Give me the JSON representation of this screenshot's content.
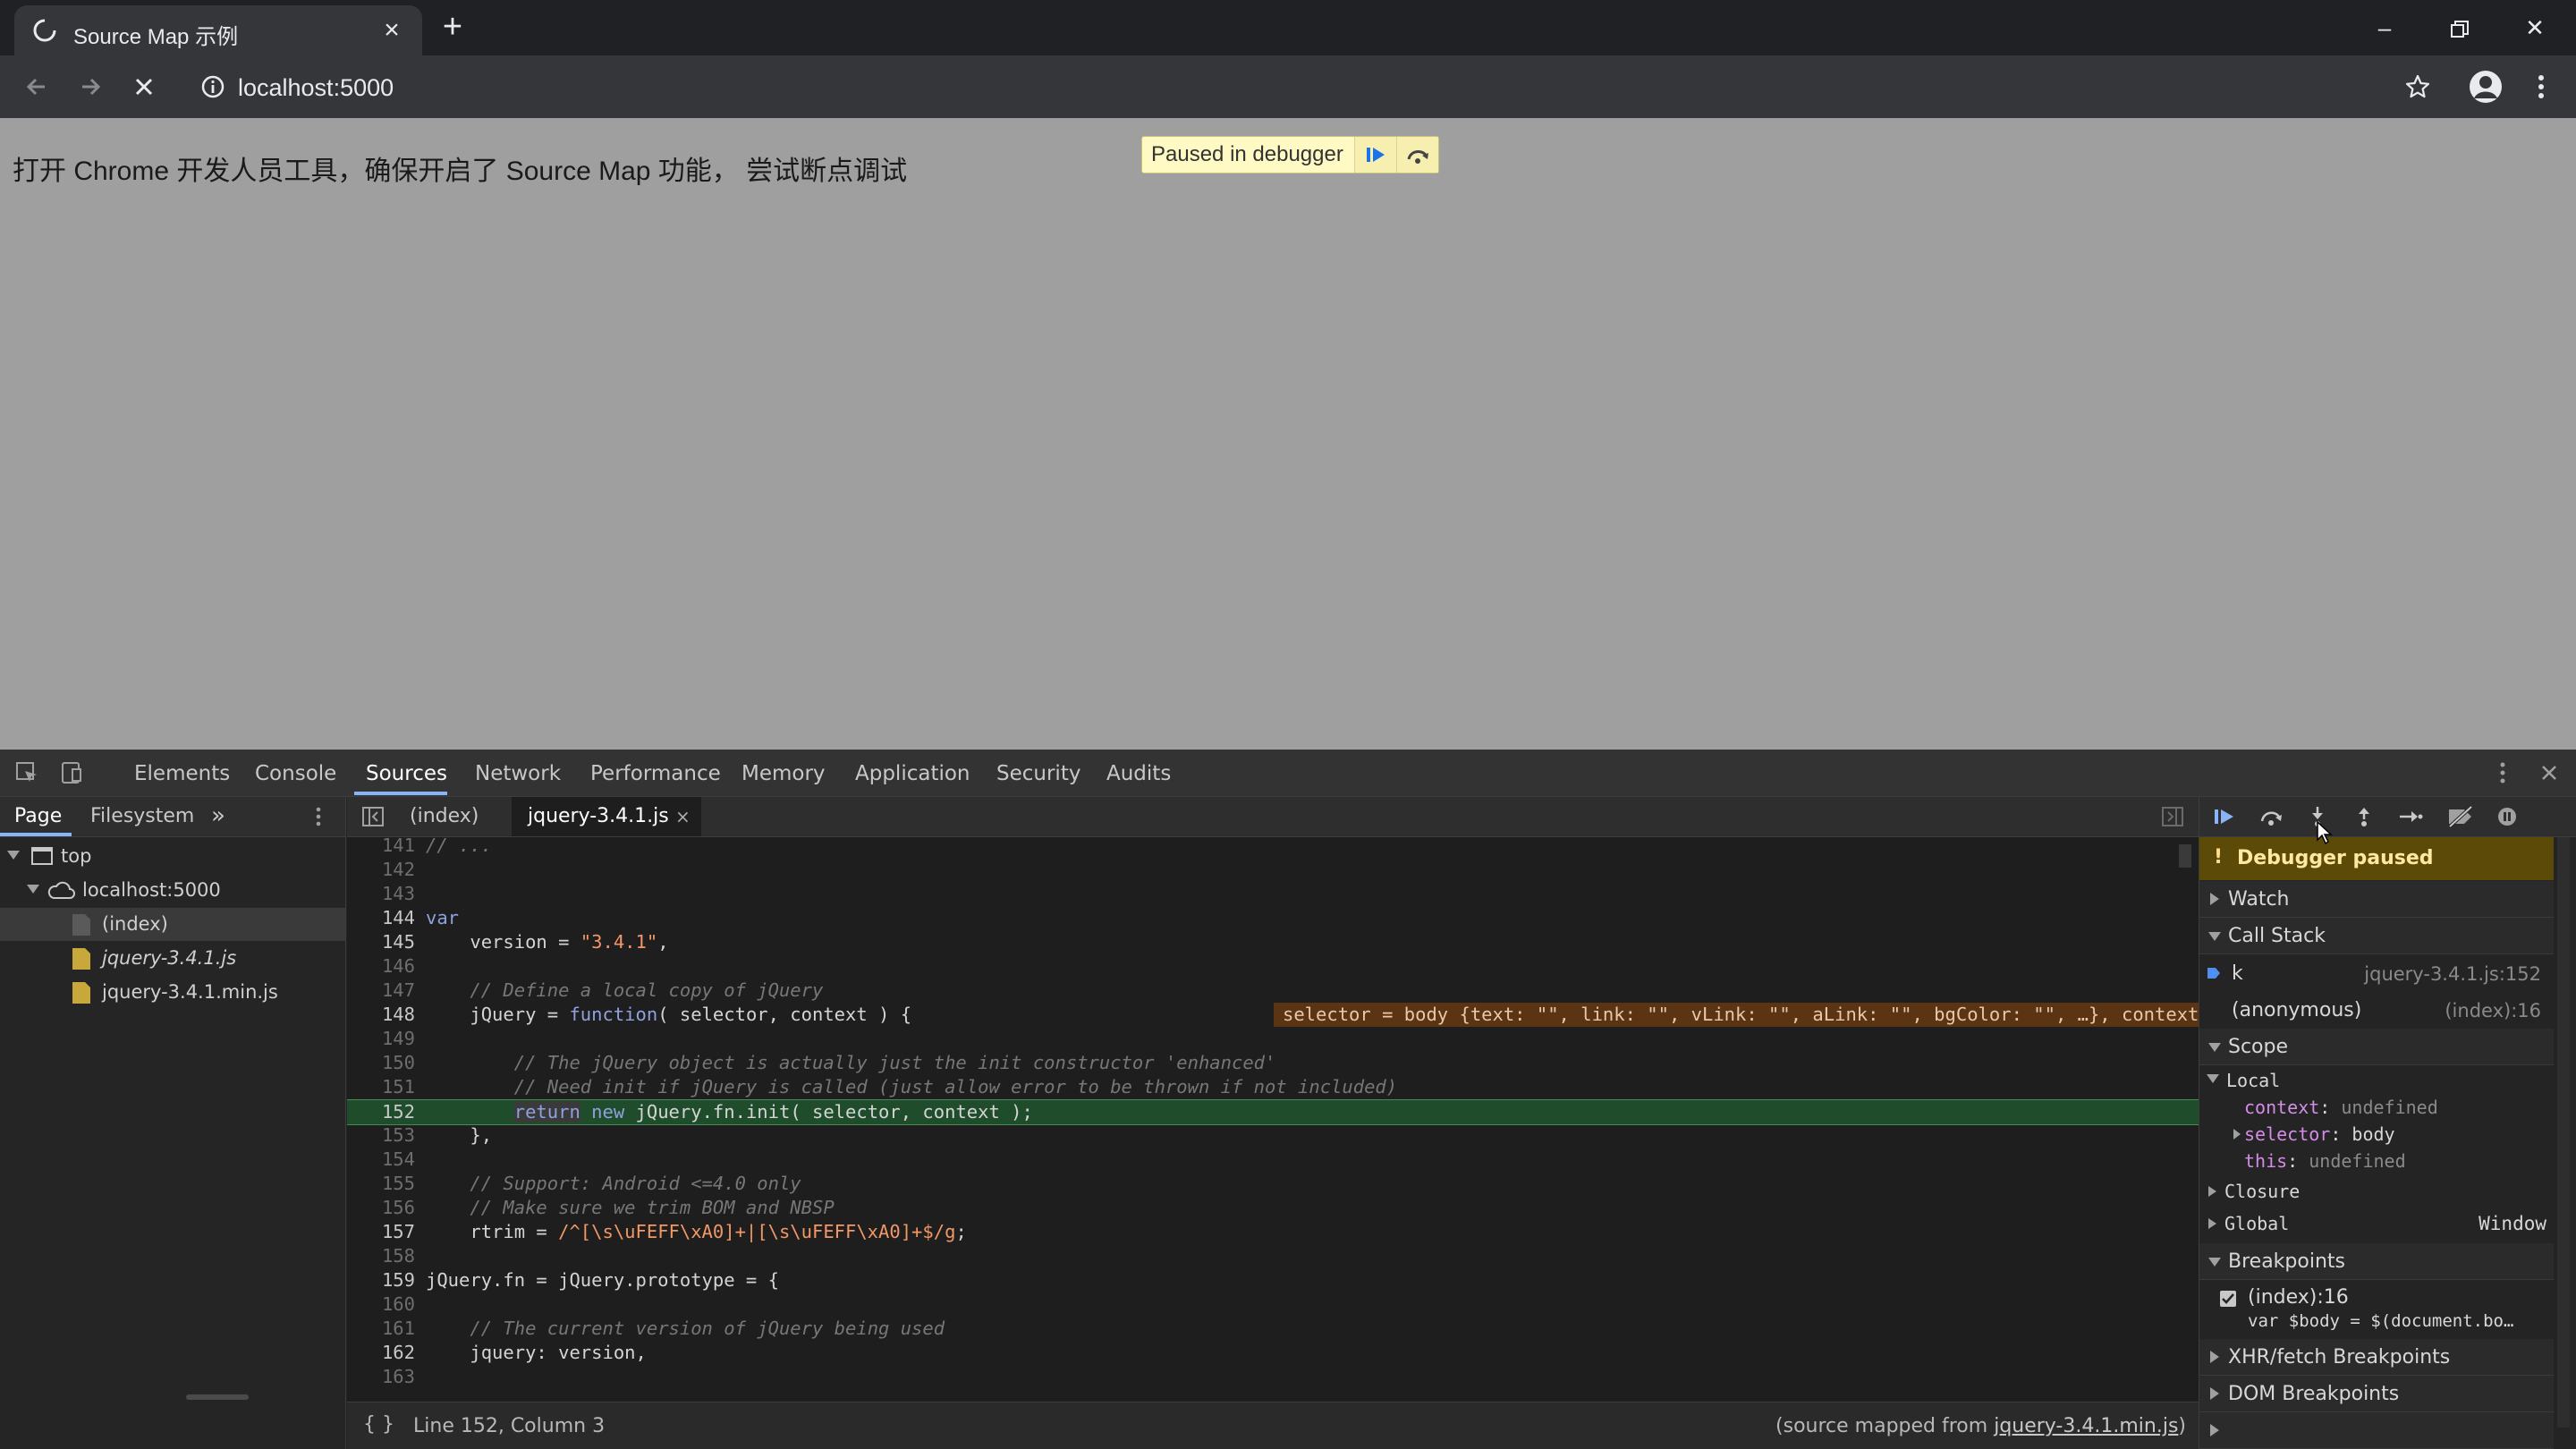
{
  "browser": {
    "tab_title": "Source Map 示例",
    "url": "localhost:5000"
  },
  "page": {
    "text": "打开 Chrome 开发人员工具，确保开启了 Source Map 功能， 尝试断点调试",
    "paused_label": "Paused in debugger"
  },
  "devtools": {
    "tabs": [
      "Elements",
      "Console",
      "Sources",
      "Network",
      "Performance",
      "Memory",
      "Application",
      "Security",
      "Audits"
    ],
    "active_tab": "Sources",
    "navigator": {
      "tabs": [
        "Page",
        "Filesystem"
      ],
      "tree": {
        "top": "top",
        "host": "localhost:5000",
        "files": [
          "(index)",
          "jquery-3.4.1.js",
          "jquery-3.4.1.min.js"
        ]
      }
    },
    "editor": {
      "tabs": [
        "(index)",
        "jquery-3.4.1.js"
      ],
      "inline_value": "selector = body {text: \"\", link: \"\", vLink: \"\", aLink: \"\", bgColor: \"\", …}, context = undefined",
      "status": {
        "position": "Line 152, Column 3",
        "mapped_prefix": "(source mapped from ",
        "mapped_link": "jquery-3.4.1.min.js",
        "mapped_suffix": ")"
      }
    },
    "debugger": {
      "paused": "Debugger paused",
      "watch": "Watch",
      "call_stack": "Call Stack",
      "frames": [
        {
          "name": "k",
          "location": "jquery-3.4.1.js:152"
        },
        {
          "name": "(anonymous)",
          "location": "(index):16"
        }
      ],
      "scope": "Scope",
      "local": "Local",
      "locals": [
        {
          "key": "context",
          "value": "undefined"
        },
        {
          "key": "selector",
          "value": "body"
        },
        {
          "key": "this",
          "value": "undefined"
        }
      ],
      "closure": "Closure",
      "global": "Global",
      "global_value": "Window",
      "breakpoints": "Breakpoints",
      "breakpoint_location": "(index):16",
      "breakpoint_code": "var $body = $(document.bo…",
      "xhr_breakpoints": "XHR/fetch Breakpoints",
      "dom_breakpoints": "DOM Breakpoints"
    }
  }
}
